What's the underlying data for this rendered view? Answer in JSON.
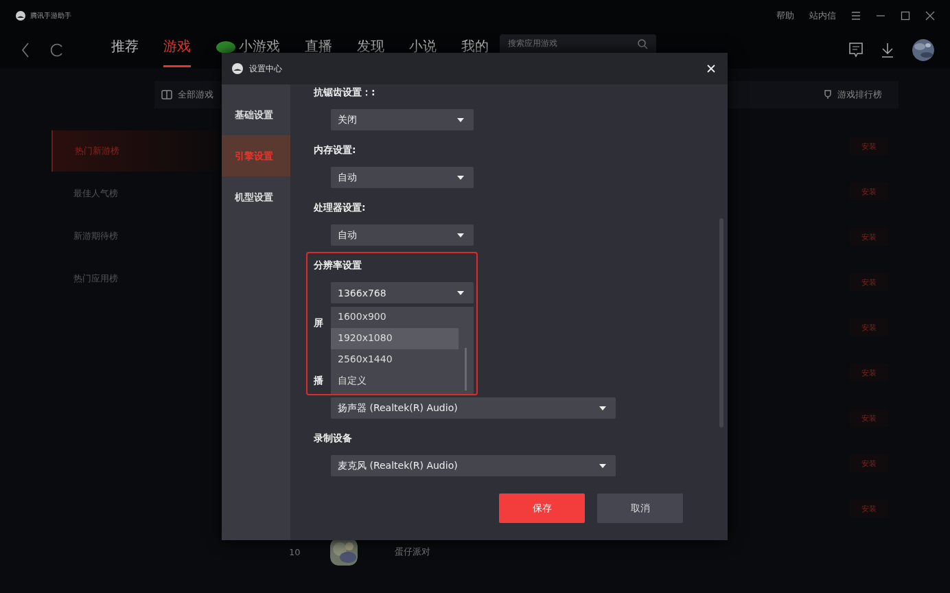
{
  "app": {
    "title": "腾讯手游助手",
    "top_links": [
      "帮助",
      "站内信"
    ]
  },
  "nav": {
    "tabs": [
      {
        "label": "推荐",
        "selected": false
      },
      {
        "label": "游戏",
        "selected": true
      },
      {
        "label": "小游戏",
        "selected": false,
        "icon": true
      },
      {
        "label": "直播",
        "selected": false
      },
      {
        "label": "发现",
        "selected": false
      },
      {
        "label": "小说",
        "selected": false
      },
      {
        "label": "我的",
        "selected": false
      }
    ],
    "search": {
      "placeholder": "搜索应用游戏"
    }
  },
  "toolbar": {
    "left": "全部游戏",
    "right": "游戏排行榜"
  },
  "rank_menu": [
    {
      "label": "热门新游榜",
      "selected": true
    },
    {
      "label": "最佳人气榜",
      "selected": false
    },
    {
      "label": "新游期待榜",
      "selected": false
    },
    {
      "label": "热门应用榜",
      "selected": false
    }
  ],
  "install_buttons": [
    "安装",
    "安装",
    "安装",
    "安装",
    "安装",
    "安装",
    "安装",
    "安装",
    "安装"
  ],
  "bottom_row": {
    "rank": "10",
    "name": "蛋仔派对"
  },
  "dialog": {
    "title": "设置中心",
    "sidebar": [
      {
        "label": "基础设置",
        "selected": false
      },
      {
        "label": "引擎设置",
        "selected": true
      },
      {
        "label": "机型设置",
        "selected": false
      }
    ],
    "settings": [
      {
        "label": "抗锯齿设置：:",
        "value": "关闭",
        "wide": false
      },
      {
        "label": "内存设置:",
        "value": "自动",
        "wide": false
      },
      {
        "label": "处理器设置:",
        "value": "自动",
        "wide": false
      },
      {
        "label": "分辨率设置",
        "value": "1366x768",
        "wide": false,
        "highlighted": true,
        "options": [
          {
            "label": "1600x900",
            "selected": false
          },
          {
            "label": "1920x1080",
            "selected": true
          },
          {
            "label": "2560x1440",
            "selected": false
          },
          {
            "label": "自定义",
            "selected": false
          }
        ]
      },
      {
        "label": "屏"
      },
      {
        "label": "播",
        "value": "扬声器 (Realtek(R) Audio)",
        "wide": true
      },
      {
        "label": "录制设备",
        "value": "麦克风 (Realtek(R) Audio)",
        "wide": true
      }
    ],
    "buttons": [
      {
        "label": "保存",
        "kind": "primary"
      },
      {
        "label": "取消",
        "kind": "secondary"
      }
    ]
  }
}
